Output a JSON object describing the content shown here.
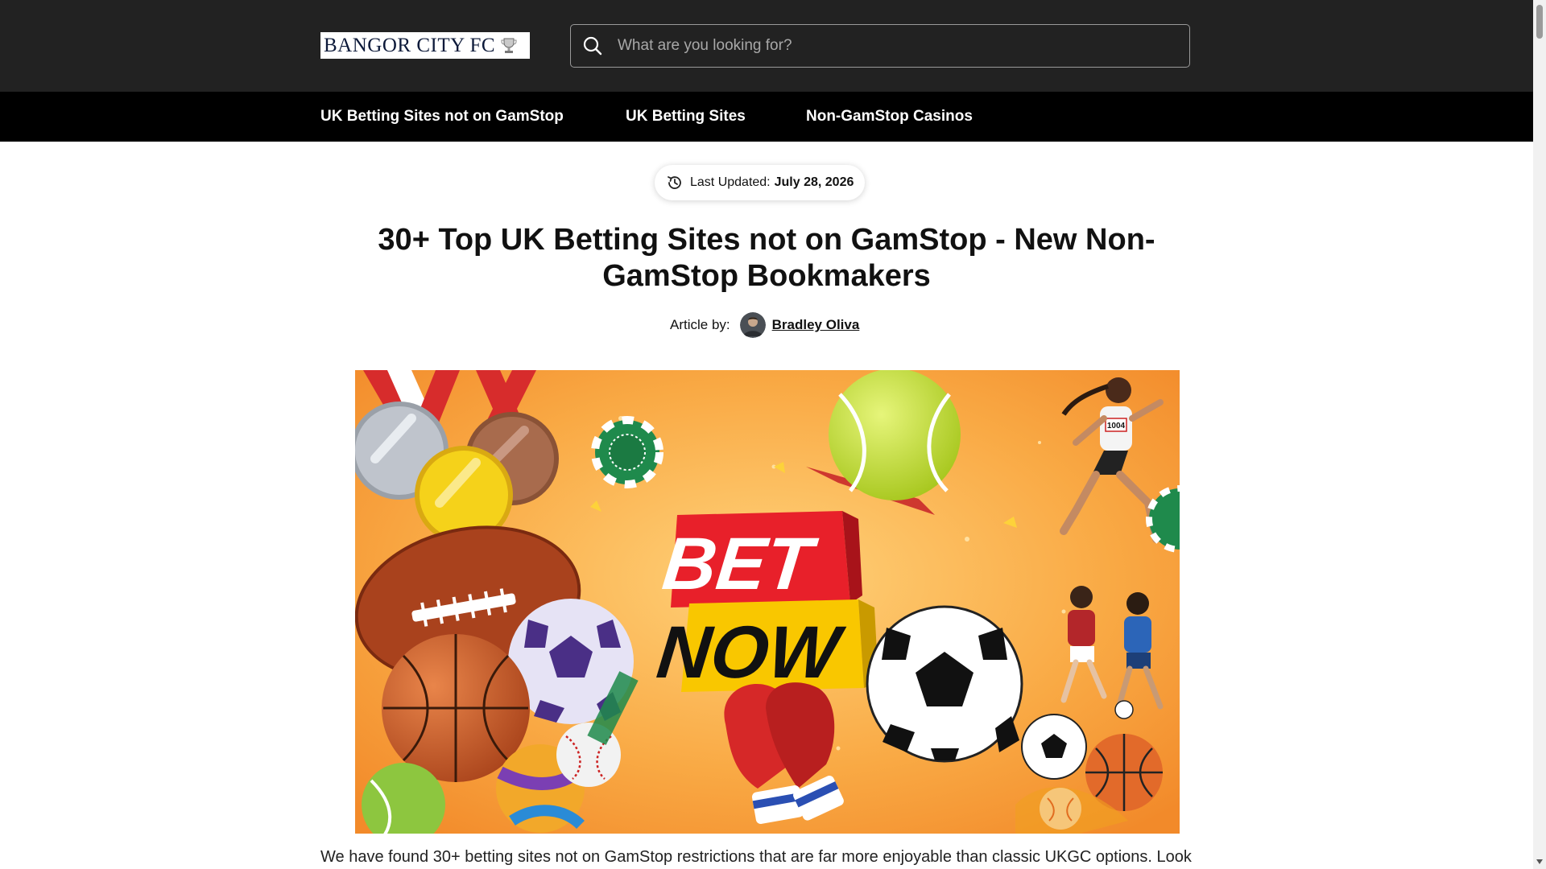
{
  "header": {
    "logo_text": "BANGOR CITY FC",
    "search_placeholder": "What are you looking for?"
  },
  "nav": {
    "items": [
      {
        "label": "UK Betting Sites not on GamStop"
      },
      {
        "label": "UK Betting Sites"
      },
      {
        "label": "Non-GamStop Casinos"
      }
    ]
  },
  "article": {
    "updated_label": "Last Updated:",
    "updated_date": "July 28, 2026",
    "title": "30+ Top UK Betting Sites not on GamStop - New Non-GamStop Bookmakers",
    "byline_label": "Article by:",
    "author": "Bradley Oliva",
    "hero": {
      "line1": "BET",
      "line2": "NOW",
      "runner_bib": "1004"
    },
    "intro": "We have found 30+ betting sites not on GamStop restrictions that are far more enjoyable than classic UKGC options. Look"
  },
  "colors": {
    "header_bg": "#222222",
    "nav_bg": "#000000",
    "hero_bg": "#f7a23a",
    "bet_red": "#e8202a",
    "now_yellow": "#f9c700"
  }
}
